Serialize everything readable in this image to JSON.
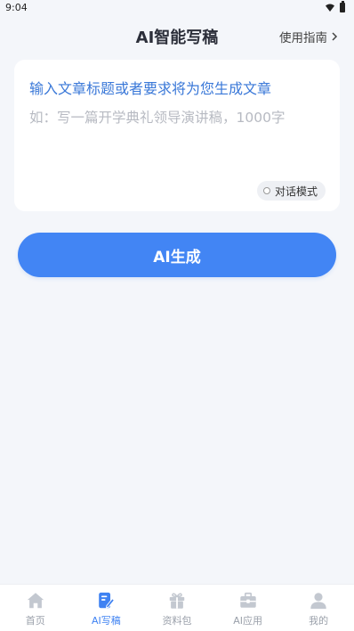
{
  "status": {
    "time": "9:04"
  },
  "header": {
    "title": "AI智能写稿",
    "guide_label": "使用指南"
  },
  "card": {
    "prompt": "输入文章标题或者要求将为您生成文章",
    "input_placeholder": "如：写一篇开学典礼领导演讲稿，1000字",
    "input_value": "",
    "mode_label": "对话模式"
  },
  "generate_label": "AI生成",
  "colors": {
    "accent": "#4285f4",
    "prompt": "#3a78d8",
    "inactive": "#9aa0aa",
    "icon_inactive": "#c3c8d0"
  },
  "tabs": [
    {
      "label": "首页",
      "icon": "home-icon",
      "active": false
    },
    {
      "label": "AI写稿",
      "icon": "write-icon",
      "active": true
    },
    {
      "label": "资料包",
      "icon": "gift-icon",
      "active": false
    },
    {
      "label": "AI应用",
      "icon": "toolbox-icon",
      "active": false
    },
    {
      "label": "我的",
      "icon": "user-icon",
      "active": false
    }
  ]
}
